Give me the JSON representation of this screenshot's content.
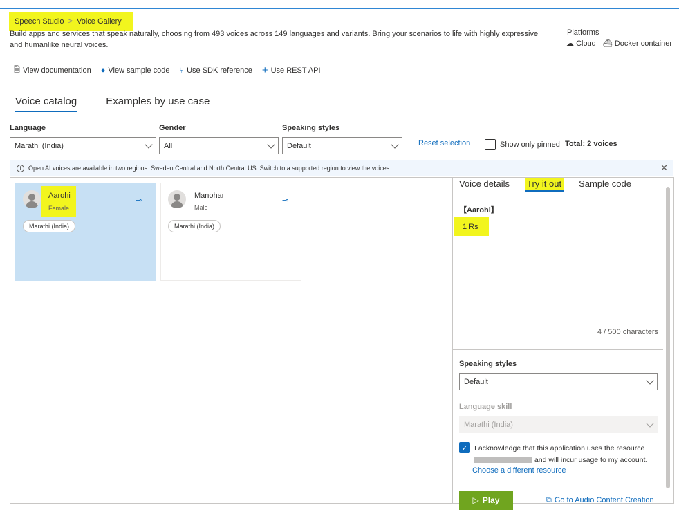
{
  "breadcrumb": {
    "root": "Speech Studio",
    "current": "Voice Gallery"
  },
  "description": "Build apps and services that speak naturally, choosing from 493 voices across 149 languages and variants. Bring your scenarios to life with highly expressive and humanlike neural voices.",
  "platforms": {
    "title": "Platforms",
    "cloud": "Cloud",
    "docker": "Docker container"
  },
  "links": {
    "documentation": "View documentation",
    "sample_code": "View sample code",
    "sdk_reference": "Use SDK reference",
    "rest_api": "Use REST API"
  },
  "tabs": {
    "voice_catalog": "Voice catalog",
    "examples": "Examples by use case"
  },
  "filters": {
    "language_label": "Language",
    "language_value": "Marathi (India)",
    "gender_label": "Gender",
    "gender_value": "All",
    "styles_label": "Speaking styles",
    "styles_value": "Default",
    "reset": "Reset selection",
    "show_pinned": "Show only pinned",
    "total": "Total: 2 voices"
  },
  "info_banner": "Open AI voices are available in two regions: Sweden Central and North Central US. Switch to a supported region to view the voices.",
  "voices": [
    {
      "name": "Aarohi",
      "gender": "Female",
      "locale": "Marathi (India)"
    },
    {
      "name": "Manohar",
      "gender": "Male",
      "locale": "Marathi (India)"
    }
  ],
  "right_panel": {
    "tabs": {
      "details": "Voice details",
      "try": "Try it out",
      "sample": "Sample code"
    },
    "voice_tag": "【Aarohi】",
    "input_text": "1 Rs",
    "char_count": "4 / 500 characters",
    "styles_label": "Speaking styles",
    "styles_value": "Default",
    "skill_label": "Language skill",
    "skill_value": "Marathi (India)",
    "ack_pre": "I acknowledge that this application uses the resource",
    "ack_post": "and will incur usage to my account.",
    "choose_resource": "Choose a different resource",
    "play": "Play",
    "audio_creation": "Go to Audio Content Creation"
  },
  "colors": {
    "accent": "#0f6cbd",
    "highlight": "#f2f51e",
    "selected_card": "#c7e0f4",
    "play": "#2b7a21"
  }
}
